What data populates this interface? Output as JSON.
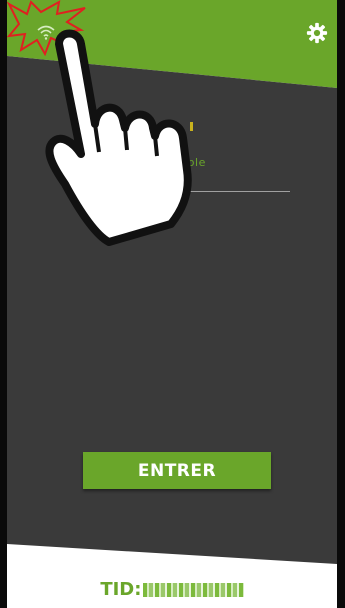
{
  "app": {
    "hint_text": "ible",
    "enter_button_label": "ENTRER",
    "tid_label": "TID:",
    "tid_value": "22792824"
  },
  "colors": {
    "accent_green": "#6aa62a",
    "dark_background": "#3a3a3a",
    "button_text": "#ffffff"
  },
  "icons": {
    "settings": "gear-icon",
    "wifi": "wifi-icon",
    "pointer": "pointing-hand-icon",
    "burst": "starburst-icon"
  }
}
